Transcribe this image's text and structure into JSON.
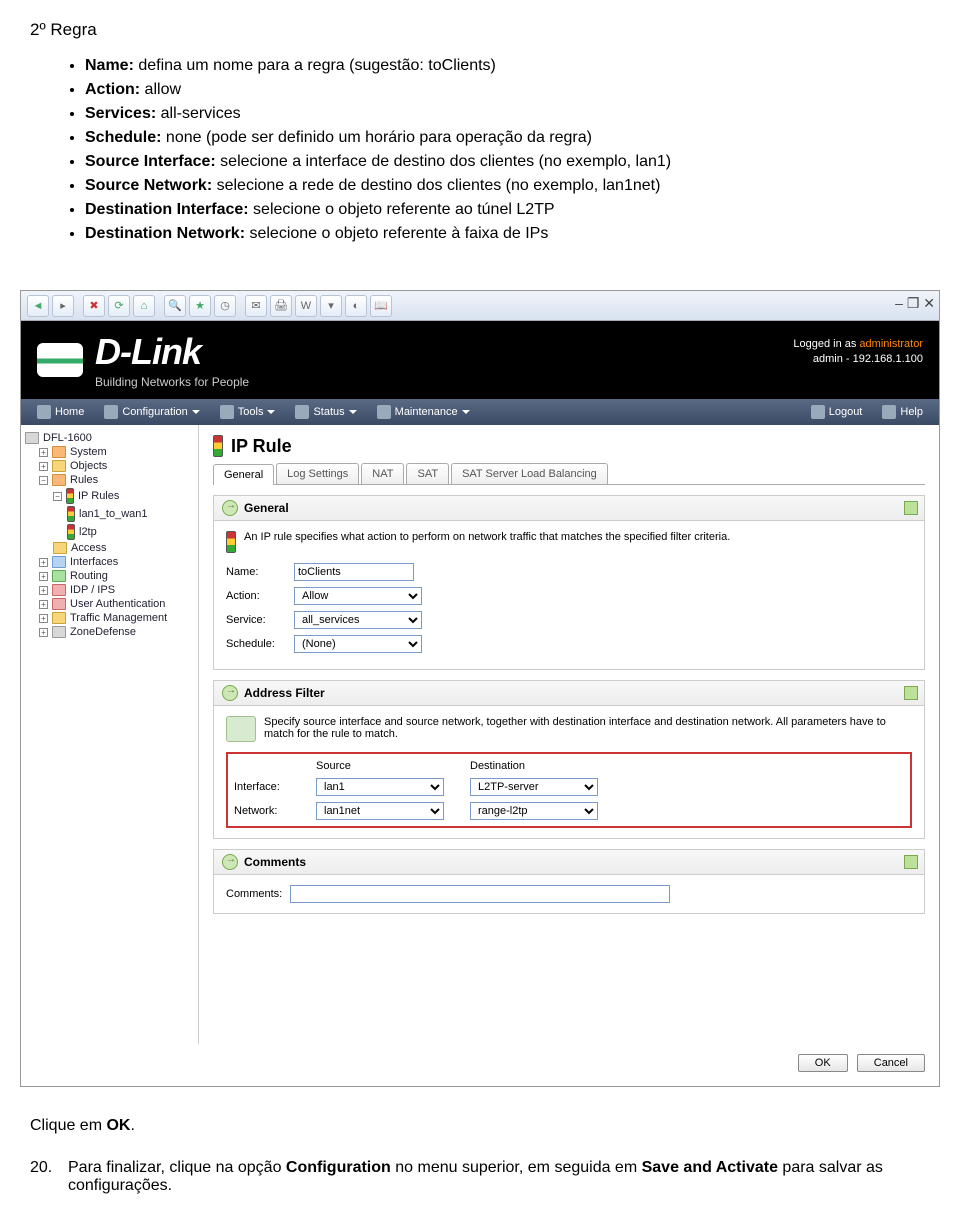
{
  "doc": {
    "rule_title": "2º Regra",
    "bullets": {
      "name_label": "Name:",
      "name_text": " defina um nome para a regra (sugestão: toClients)",
      "action_label": "Action:",
      "action_text": " allow",
      "services_label": "Services:",
      "services_text": " all-services",
      "schedule_label": "Schedule:",
      "schedule_text": " none (pode ser definido um horário para operação da regra)",
      "srcif_label": "Source Interface:",
      "srcif_text": " selecione a interface de destino dos clientes (no exemplo, lan1)",
      "srcnet_label": "Source Network:",
      "srcnet_text": " selecione a rede de destino dos clientes (no exemplo, lan1net)",
      "dstif_label": "Destination Interface:",
      "dstif_text": " selecione o objeto referente ao túnel L2TP",
      "dstnet_label": "Destination Network:",
      "dstnet_text": " selecione o objeto referente à faixa de IPs"
    },
    "click_ok_pre": "Clique em ",
    "click_ok_bold": "OK",
    "click_ok_post": ".",
    "step20_num": "20.",
    "step20_pre": "Para finalizar, clique na opção ",
    "step20_b1": "Configuration",
    "step20_mid": " no menu superior, em seguida em ",
    "step20_b2": "Save and Activate",
    "step20_post": " para salvar as configurações."
  },
  "ui": {
    "win_ctrl": "‒ ❐ ✕",
    "logo": "D-Link",
    "logo_tag": "Building Networks for People",
    "logged_pre": "Logged in as ",
    "logged_user": "administrator",
    "logged_sub": "admin - 192.168.1.100",
    "menu": {
      "home": "Home",
      "config": "Configuration",
      "tools": "Tools",
      "status": "Status",
      "maint": "Maintenance",
      "logout": "Logout",
      "help": "Help"
    },
    "tree": {
      "root": "DFL-1600",
      "system": "System",
      "objects": "Objects",
      "rules": "Rules",
      "iprules": "IP Rules",
      "lan1wan1": "lan1_to_wan1",
      "l2tp": "l2tp",
      "access": "Access",
      "interfaces": "Interfaces",
      "routing": "Routing",
      "idp": "IDP / IPS",
      "userauth": "User Authentication",
      "traffic": "Traffic Management",
      "zone": "ZoneDefense"
    },
    "page_title": "IP Rule",
    "tabs": [
      "General",
      "Log Settings",
      "NAT",
      "SAT",
      "SAT Server Load Balancing"
    ],
    "section_general": "General",
    "general_desc": "An IP rule specifies what action to perform on network traffic that matches the specified filter criteria.",
    "labels": {
      "name": "Name:",
      "action": "Action:",
      "service": "Service:",
      "schedule": "Schedule:"
    },
    "values": {
      "name": "toClients",
      "action": "Allow",
      "service": "all_services",
      "schedule": "(None)"
    },
    "section_filter": "Address Filter",
    "filter_desc": "Specify source interface and source network, together with destination interface and destination network. All parameters have to match for the rule to match.",
    "filter": {
      "source_hdr": "Source",
      "dest_hdr": "Destination",
      "interface_lbl": "Interface:",
      "network_lbl": "Network:",
      "src_if": "lan1",
      "dst_if": "L2TP-server",
      "src_net": "lan1net",
      "dst_net": "range-l2tp"
    },
    "section_comments": "Comments",
    "comments_label": "Comments:",
    "comments_value": "",
    "btn_ok": "OK",
    "btn_cancel": "Cancel"
  }
}
